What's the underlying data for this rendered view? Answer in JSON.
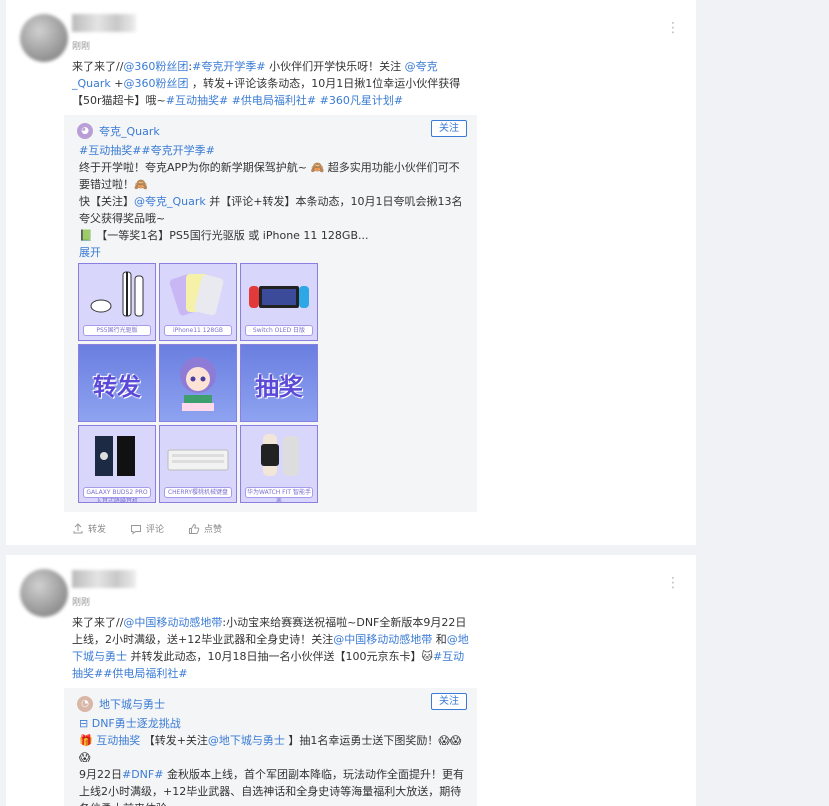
{
  "post1": {
    "time": "刚刚",
    "more_icon": "⋮",
    "text_segments": [
      {
        "t": "来了来了//",
        "link": false
      },
      {
        "t": "@360粉丝团",
        "link": true
      },
      {
        "t": ":",
        "link": false
      },
      {
        "t": "#夸克开学季#",
        "link": true
      },
      {
        "t": " 小伙伴们开学快乐呀！关注 ",
        "link": false
      },
      {
        "t": "@夸克_Quark",
        "link": true
      },
      {
        "t": " +",
        "link": false
      },
      {
        "t": "@360粉丝团",
        "link": true
      },
      {
        "t": " ，转发+评论该条动态，10月1日揪1位幸运小伙伴获得【50r猫超卡】哦~",
        "link": false
      },
      {
        "t": "#互动抽奖#",
        "link": true
      },
      {
        "t": " ",
        "link": false
      },
      {
        "t": "#供电局福利社#",
        "link": true
      },
      {
        "t": " ",
        "link": false
      },
      {
        "t": "#360凡星计划#",
        "link": true
      }
    ],
    "repost": {
      "author": "夸克_Quark",
      "follow_label": "关注",
      "tags": "#互动抽奖##夸克开学季#",
      "line1": "终于开学啦！夸克APP为你的新学期保驾护航~ 🙈 超多实用功能小伙伴们可不要错过啦！🙈",
      "line2_prefix": "快【关注】",
      "line2_link": "@夸克_Quark",
      "line2_suffix": " 并【评论+转发】本条动态，10月1日夸叽会揪13名夸父获得奖品哦~",
      "line3": "📗 【一等奖1名】PS5国行光驱版 或 iPhone 11 128GB...",
      "expand": "展开",
      "grid": [
        {
          "caption": "PS5国行光驱版",
          "kind": "ps5"
        },
        {
          "caption": "iPhone11 128GB",
          "kind": "iphone"
        },
        {
          "caption": "Switch OLED 日版",
          "kind": "switch"
        },
        {
          "caption": "转发",
          "kind": "word"
        },
        {
          "caption": "",
          "kind": "girl"
        },
        {
          "caption": "抽奖",
          "kind": "word"
        },
        {
          "caption": "GALAXY BUDS2 PRO 入耳式降噪耳机",
          "kind": "buds"
        },
        {
          "caption": "CHERRY樱桃机械键盘",
          "kind": "keyboard"
        },
        {
          "caption": "华为WATCH FIT 智能手表",
          "kind": "watch"
        }
      ]
    },
    "actions": {
      "repost": "转发",
      "comment": "评论",
      "like": "点赞"
    }
  },
  "post2": {
    "time": "刚刚",
    "more_icon": "⋮",
    "text_segments": [
      {
        "t": "来了来了//",
        "link": false
      },
      {
        "t": "@中国移动动感地带",
        "link": true
      },
      {
        "t": ":小动宝来给赛赛送祝福啦~DNF全新版本9月22日上线，2小时满级，送+12毕业武器和全身史诗！关注",
        "link": false
      },
      {
        "t": "@中国移动动感地带",
        "link": true
      },
      {
        "t": " 和",
        "link": false
      },
      {
        "t": "@地下城与勇士",
        "link": true
      },
      {
        "t": " 并转发此动态，10月18日抽一名小伙伴送【100元京东卡】🐱",
        "link": false
      },
      {
        "t": "#互动抽奖##供电局福利社#",
        "link": true
      }
    ],
    "repost": {
      "author": "地下城与勇士",
      "follow_label": "关注",
      "topic": "DNF勇士逐龙挑战",
      "lottery_label": "互动抽奖",
      "lottery_text_a": " 【转发+关注",
      "lottery_link": "@地下城与勇士",
      "lottery_text_b": " 】抽1名幸运勇士送下图奖励！😱😱😱",
      "line4_prefix": "9月22日",
      "line4_link": "#DNF#",
      "line4_suffix": " 金秋版本上线，首个军团副本降临，玩法动作全面提升！更有上线2小时满级，+12毕业武器、自选神话和全身史诗等海量福利大放送，期待各位勇士前来体验~"
    }
  }
}
